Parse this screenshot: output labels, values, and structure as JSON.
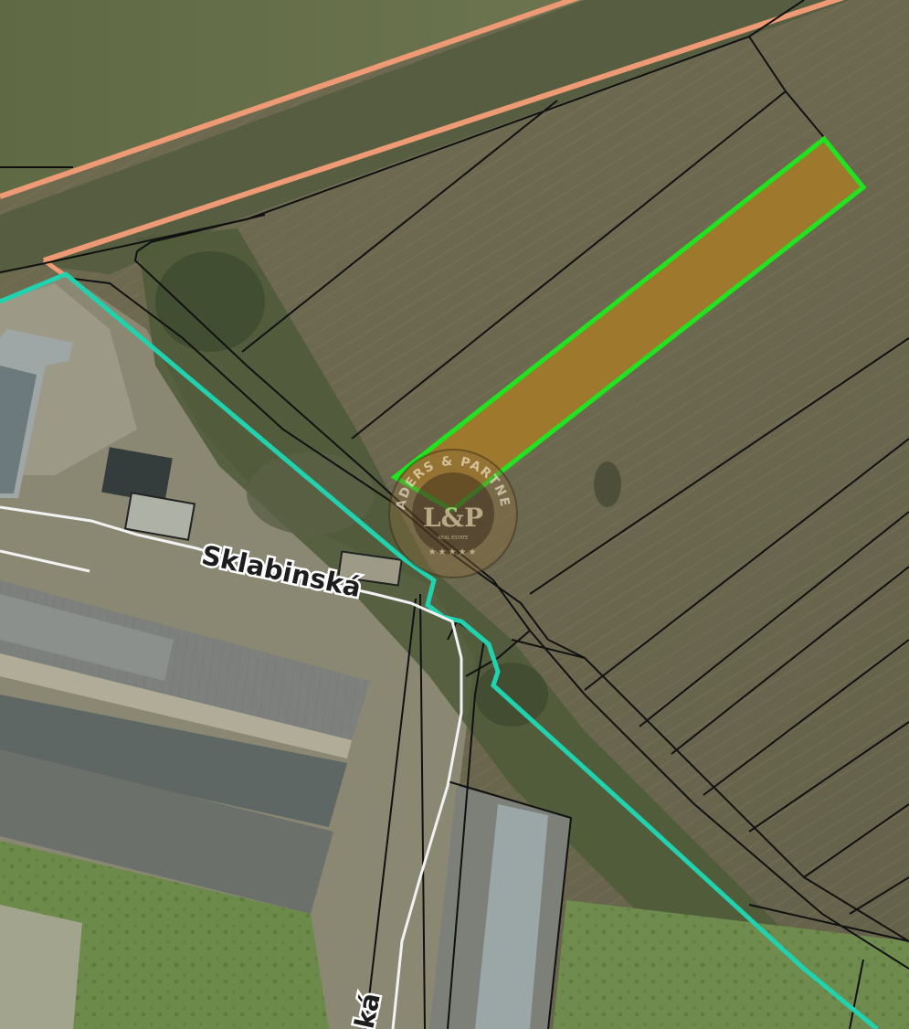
{
  "map": {
    "streets": [
      {
        "id": "sklabinska",
        "label": "Sklabinská"
      },
      {
        "id": "side-street",
        "label": "ká"
      }
    ],
    "watermark": {
      "arc_text": "LEADERS & PARTNERS",
      "monogram": "L&P",
      "subtext": "REAL ESTATE",
      "stars": "★★★★★"
    },
    "colors": {
      "highlighted_parcel_fill": "#a2792a",
      "highlighted_parcel_outline": "#1fe41f",
      "cadastral_boundary": "#20d3ae",
      "railway_strip": "#ee9a74",
      "parcel_lines": "#111111",
      "street_line": "#f2f2f2"
    }
  }
}
